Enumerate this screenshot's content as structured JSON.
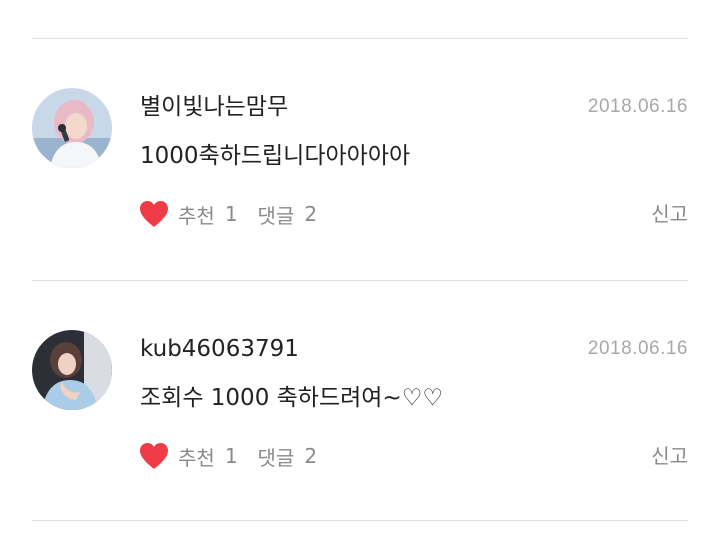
{
  "comments": [
    {
      "username": "별이빛나는맘무",
      "date": "2018.06.16",
      "text": "1000축하드립니다아아아아",
      "like_label": "추천",
      "like_count": "1",
      "reply_label": "댓글",
      "reply_count": "2",
      "report_label": "신고"
    },
    {
      "username": "kub46063791",
      "date": "2018.06.16",
      "text": "조회수 1000 축하드려여~♡♡",
      "like_label": "추천",
      "like_count": "1",
      "reply_label": "댓글",
      "reply_count": "2",
      "report_label": "신고"
    }
  ],
  "icons": {
    "like": "heart-icon"
  },
  "colors": {
    "heart": "#ee3b45",
    "meta_text": "#8a8a8a",
    "date_text": "#a8a8a8",
    "divider": "#dedede"
  }
}
